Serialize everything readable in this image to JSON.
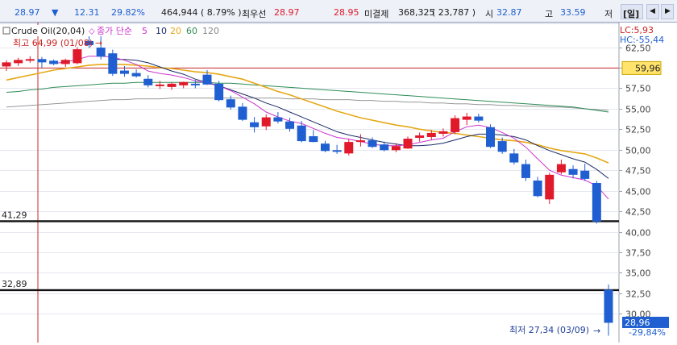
{
  "colors": {
    "up": "#e0192b",
    "down": "#1f5fd1",
    "ma5": "#cc33cc",
    "ma10": "#1a2a66",
    "ma20": "#e6a817",
    "ma60": "#2e8b57",
    "ma120": "#888888",
    "price_box": "#1f5fd1",
    "level_box": "#ffe36b"
  },
  "ticker": {
    "price": "28.97",
    "change_icon": "down-triangle-icon",
    "change": "12.31",
    "change_pct": "29.82%",
    "volume": "464,944",
    "volume_pct": "( 8.79% )",
    "best_ask_label": "최우선",
    "best_ask": "28.97",
    "best_bid": "28.95",
    "open_interest_label": "미결제",
    "open_interest": "368,325",
    "open_interest_change": "( 23,787 )",
    "open_label": "시",
    "open": "32.87",
    "high_label": "고",
    "high": "33.59",
    "low_label": "저",
    "period_button": "[일]"
  },
  "legend": {
    "title": "Crude Oil(20,04)",
    "ma_label": "종가 단순",
    "ma_periods": [
      "5",
      "10",
      "20",
      "60",
      "120"
    ]
  },
  "annotations": {
    "lc": "LC:5,93",
    "hc": "HC:-55,44",
    "high_label": "최고 64,99 (01/08)",
    "low_label": "최저 27,34 (03/09)",
    "level1": "41,29",
    "level2": "32,89",
    "current_price": "28,96",
    "current_change": "-29,84%",
    "ref_price": "59,96"
  },
  "chart_data": {
    "type": "candlestick",
    "ylim": [
      26.5,
      65.5
    ],
    "y_ticks": [
      "62,50",
      "60,00",
      "57,50",
      "55,00",
      "52,50",
      "50,00",
      "47,50",
      "45,00",
      "42,50",
      "40,00",
      "37,50",
      "35,00",
      "32,50",
      "30,00"
    ],
    "y_tick_values": [
      62.5,
      60,
      57.5,
      55,
      52.5,
      50,
      47.5,
      45,
      42.5,
      40,
      37.5,
      35,
      32.5,
      30
    ],
    "reference_levels": [
      59.96
    ],
    "support_levels": [
      41.29,
      32.89
    ],
    "candles": [
      {
        "o": 60.2,
        "h": 60.9,
        "l": 59.6,
        "c": 60.6
      },
      {
        "o": 60.6,
        "h": 61.2,
        "l": 60.2,
        "c": 60.9
      },
      {
        "o": 60.9,
        "h": 61.4,
        "l": 60.6,
        "c": 61.0
      },
      {
        "o": 61.0,
        "h": 61.3,
        "l": 60.0,
        "c": 60.7
      },
      {
        "o": 60.8,
        "h": 61.0,
        "l": 60.3,
        "c": 60.5
      },
      {
        "o": 60.5,
        "h": 61.1,
        "l": 60.1,
        "c": 60.9
      },
      {
        "o": 60.6,
        "h": 62.5,
        "l": 60.4,
        "c": 62.2
      },
      {
        "o": 63.2,
        "h": 64.2,
        "l": 62.4,
        "c": 62.8
      },
      {
        "o": 62.4,
        "h": 64.99,
        "l": 61.0,
        "c": 61.4
      },
      {
        "o": 61.7,
        "h": 62.2,
        "l": 59.0,
        "c": 59.3
      },
      {
        "o": 59.6,
        "h": 60.2,
        "l": 58.9,
        "c": 59.3
      },
      {
        "o": 59.3,
        "h": 59.8,
        "l": 58.8,
        "c": 59.0
      },
      {
        "o": 58.6,
        "h": 59.1,
        "l": 57.6,
        "c": 57.9
      },
      {
        "o": 57.9,
        "h": 58.4,
        "l": 57.4,
        "c": 57.9
      },
      {
        "o": 57.7,
        "h": 58.2,
        "l": 57.3,
        "c": 58.0
      },
      {
        "o": 57.9,
        "h": 58.3,
        "l": 57.5,
        "c": 58.2
      },
      {
        "o": 58.0,
        "h": 58.5,
        "l": 57.5,
        "c": 57.9
      },
      {
        "o": 59.1,
        "h": 59.7,
        "l": 57.9,
        "c": 58.0
      },
      {
        "o": 58.0,
        "h": 58.4,
        "l": 55.9,
        "c": 56.1
      },
      {
        "o": 56.1,
        "h": 56.6,
        "l": 54.9,
        "c": 55.2
      },
      {
        "o": 55.2,
        "h": 55.7,
        "l": 53.5,
        "c": 53.7
      },
      {
        "o": 53.3,
        "h": 54.0,
        "l": 52.1,
        "c": 52.8
      },
      {
        "o": 52.9,
        "h": 54.3,
        "l": 52.4,
        "c": 53.9
      },
      {
        "o": 53.9,
        "h": 54.6,
        "l": 53.2,
        "c": 53.5
      },
      {
        "o": 53.4,
        "h": 53.9,
        "l": 52.2,
        "c": 52.6
      },
      {
        "o": 52.9,
        "h": 53.5,
        "l": 50.9,
        "c": 51.1
      },
      {
        "o": 51.6,
        "h": 52.4,
        "l": 50.9,
        "c": 51.0
      },
      {
        "o": 50.7,
        "h": 51.1,
        "l": 49.7,
        "c": 49.9
      },
      {
        "o": 49.9,
        "h": 50.6,
        "l": 49.5,
        "c": 49.8
      },
      {
        "o": 49.6,
        "h": 51.3,
        "l": 49.3,
        "c": 50.9
      },
      {
        "o": 51.0,
        "h": 51.9,
        "l": 50.4,
        "c": 51.1
      },
      {
        "o": 51.1,
        "h": 51.5,
        "l": 50.2,
        "c": 50.4
      },
      {
        "o": 50.6,
        "h": 51.0,
        "l": 49.8,
        "c": 50.0
      },
      {
        "o": 50.0,
        "h": 50.8,
        "l": 49.7,
        "c": 50.4
      },
      {
        "o": 50.2,
        "h": 51.6,
        "l": 50.1,
        "c": 51.3
      },
      {
        "o": 51.5,
        "h": 52.1,
        "l": 51.0,
        "c": 51.7
      },
      {
        "o": 51.6,
        "h": 52.4,
        "l": 51.2,
        "c": 52.0
      },
      {
        "o": 52.0,
        "h": 52.6,
        "l": 51.6,
        "c": 52.2
      },
      {
        "o": 52.2,
        "h": 54.2,
        "l": 51.9,
        "c": 53.8
      },
      {
        "o": 53.7,
        "h": 54.5,
        "l": 53.0,
        "c": 54.0
      },
      {
        "o": 54.0,
        "h": 54.4,
        "l": 53.3,
        "c": 53.6
      },
      {
        "o": 52.7,
        "h": 53.1,
        "l": 50.2,
        "c": 50.4
      },
      {
        "o": 51.0,
        "h": 51.5,
        "l": 49.5,
        "c": 49.8
      },
      {
        "o": 49.5,
        "h": 50.1,
        "l": 48.2,
        "c": 48.5
      },
      {
        "o": 48.2,
        "h": 48.8,
        "l": 46.2,
        "c": 46.6
      },
      {
        "o": 46.2,
        "h": 46.7,
        "l": 44.2,
        "c": 44.4
      },
      {
        "o": 44.0,
        "h": 47.2,
        "l": 43.4,
        "c": 46.9
      },
      {
        "o": 47.3,
        "h": 48.8,
        "l": 47.0,
        "c": 48.2
      },
      {
        "o": 47.6,
        "h": 48.1,
        "l": 46.5,
        "c": 47.0
      },
      {
        "o": 47.4,
        "h": 48.3,
        "l": 46.2,
        "c": 46.5
      },
      {
        "o": 45.9,
        "h": 46.2,
        "l": 41.0,
        "c": 41.3
      },
      {
        "o": 32.9,
        "h": 33.59,
        "l": 27.34,
        "c": 28.96
      }
    ],
    "ma5": [
      null,
      null,
      null,
      null,
      60.5,
      60.7,
      61.0,
      61.4,
      61.4,
      61.3,
      60.9,
      60.4,
      59.6,
      59.3,
      59.1,
      58.8,
      58.4,
      58.1,
      57.8,
      57.2,
      56.4,
      55.6,
      54.6,
      54.0,
      53.5,
      53.2,
      52.6,
      52.0,
      51.5,
      51.3,
      51.0,
      50.7,
      50.5,
      50.5,
      50.6,
      50.9,
      51.2,
      51.4,
      52.2,
      52.8,
      53.0,
      52.7,
      52.1,
      51.4,
      50.3,
      48.9,
      47.5,
      46.9,
      46.6,
      46.3,
      45.6,
      44.0
    ],
    "ma10": [
      null,
      null,
      null,
      null,
      null,
      null,
      null,
      null,
      null,
      61.0,
      61.0,
      60.9,
      60.6,
      60.1,
      59.6,
      59.2,
      58.6,
      58.2,
      57.8,
      57.3,
      56.8,
      56.3,
      55.7,
      55.2,
      54.6,
      54.0,
      53.4,
      52.8,
      52.2,
      51.8,
      51.5,
      51.2,
      50.9,
      50.7,
      50.5,
      50.5,
      50.6,
      50.8,
      51.2,
      51.6,
      51.9,
      51.9,
      51.8,
      51.6,
      51.2,
      50.5,
      49.9,
      49.4,
      48.9,
      48.5,
      47.6,
      46.5
    ],
    "ma20": [
      58.5,
      58.8,
      59.1,
      59.4,
      59.7,
      59.9,
      60.1,
      60.3,
      60.4,
      60.4,
      60.4,
      60.3,
      60.2,
      60.0,
      59.9,
      59.7,
      59.5,
      59.4,
      59.2,
      58.9,
      58.6,
      58.1,
      57.6,
      57.1,
      56.7,
      56.2,
      55.7,
      55.2,
      54.7,
      54.3,
      53.9,
      53.6,
      53.3,
      53.0,
      52.8,
      52.5,
      52.3,
      52.1,
      52.0,
      51.8,
      51.6,
      51.4,
      51.2,
      51.1,
      50.9,
      50.6,
      50.2,
      49.9,
      49.7,
      49.5,
      49.0,
      48.4
    ],
    "ma60": [
      57.0,
      57.1,
      57.3,
      57.4,
      57.6,
      57.7,
      57.8,
      57.9,
      58.0,
      58.1,
      58.1,
      58.2,
      58.2,
      58.2,
      58.2,
      58.2,
      58.2,
      58.2,
      58.1,
      58.1,
      58.0,
      57.9,
      57.8,
      57.7,
      57.6,
      57.5,
      57.4,
      57.3,
      57.2,
      57.1,
      57.0,
      56.9,
      56.8,
      56.7,
      56.6,
      56.5,
      56.4,
      56.3,
      56.2,
      56.1,
      56.0,
      55.9,
      55.8,
      55.7,
      55.6,
      55.5,
      55.4,
      55.3,
      55.2,
      55.0,
      54.8,
      54.6
    ],
    "ma120": [
      55.2,
      55.3,
      55.4,
      55.5,
      55.6,
      55.7,
      55.8,
      55.9,
      56.0,
      56.1,
      56.1,
      56.2,
      56.2,
      56.2,
      56.3,
      56.3,
      56.3,
      56.3,
      56.3,
      56.3,
      56.3,
      56.3,
      56.3,
      56.3,
      56.2,
      56.2,
      56.2,
      56.1,
      56.1,
      56.1,
      56.0,
      56.0,
      55.9,
      55.9,
      55.8,
      55.8,
      55.7,
      55.7,
      55.6,
      55.6,
      55.5,
      55.5,
      55.4,
      55.4,
      55.3,
      55.3,
      55.2,
      55.2,
      55.1,
      55.0,
      54.9,
      54.8
    ]
  }
}
